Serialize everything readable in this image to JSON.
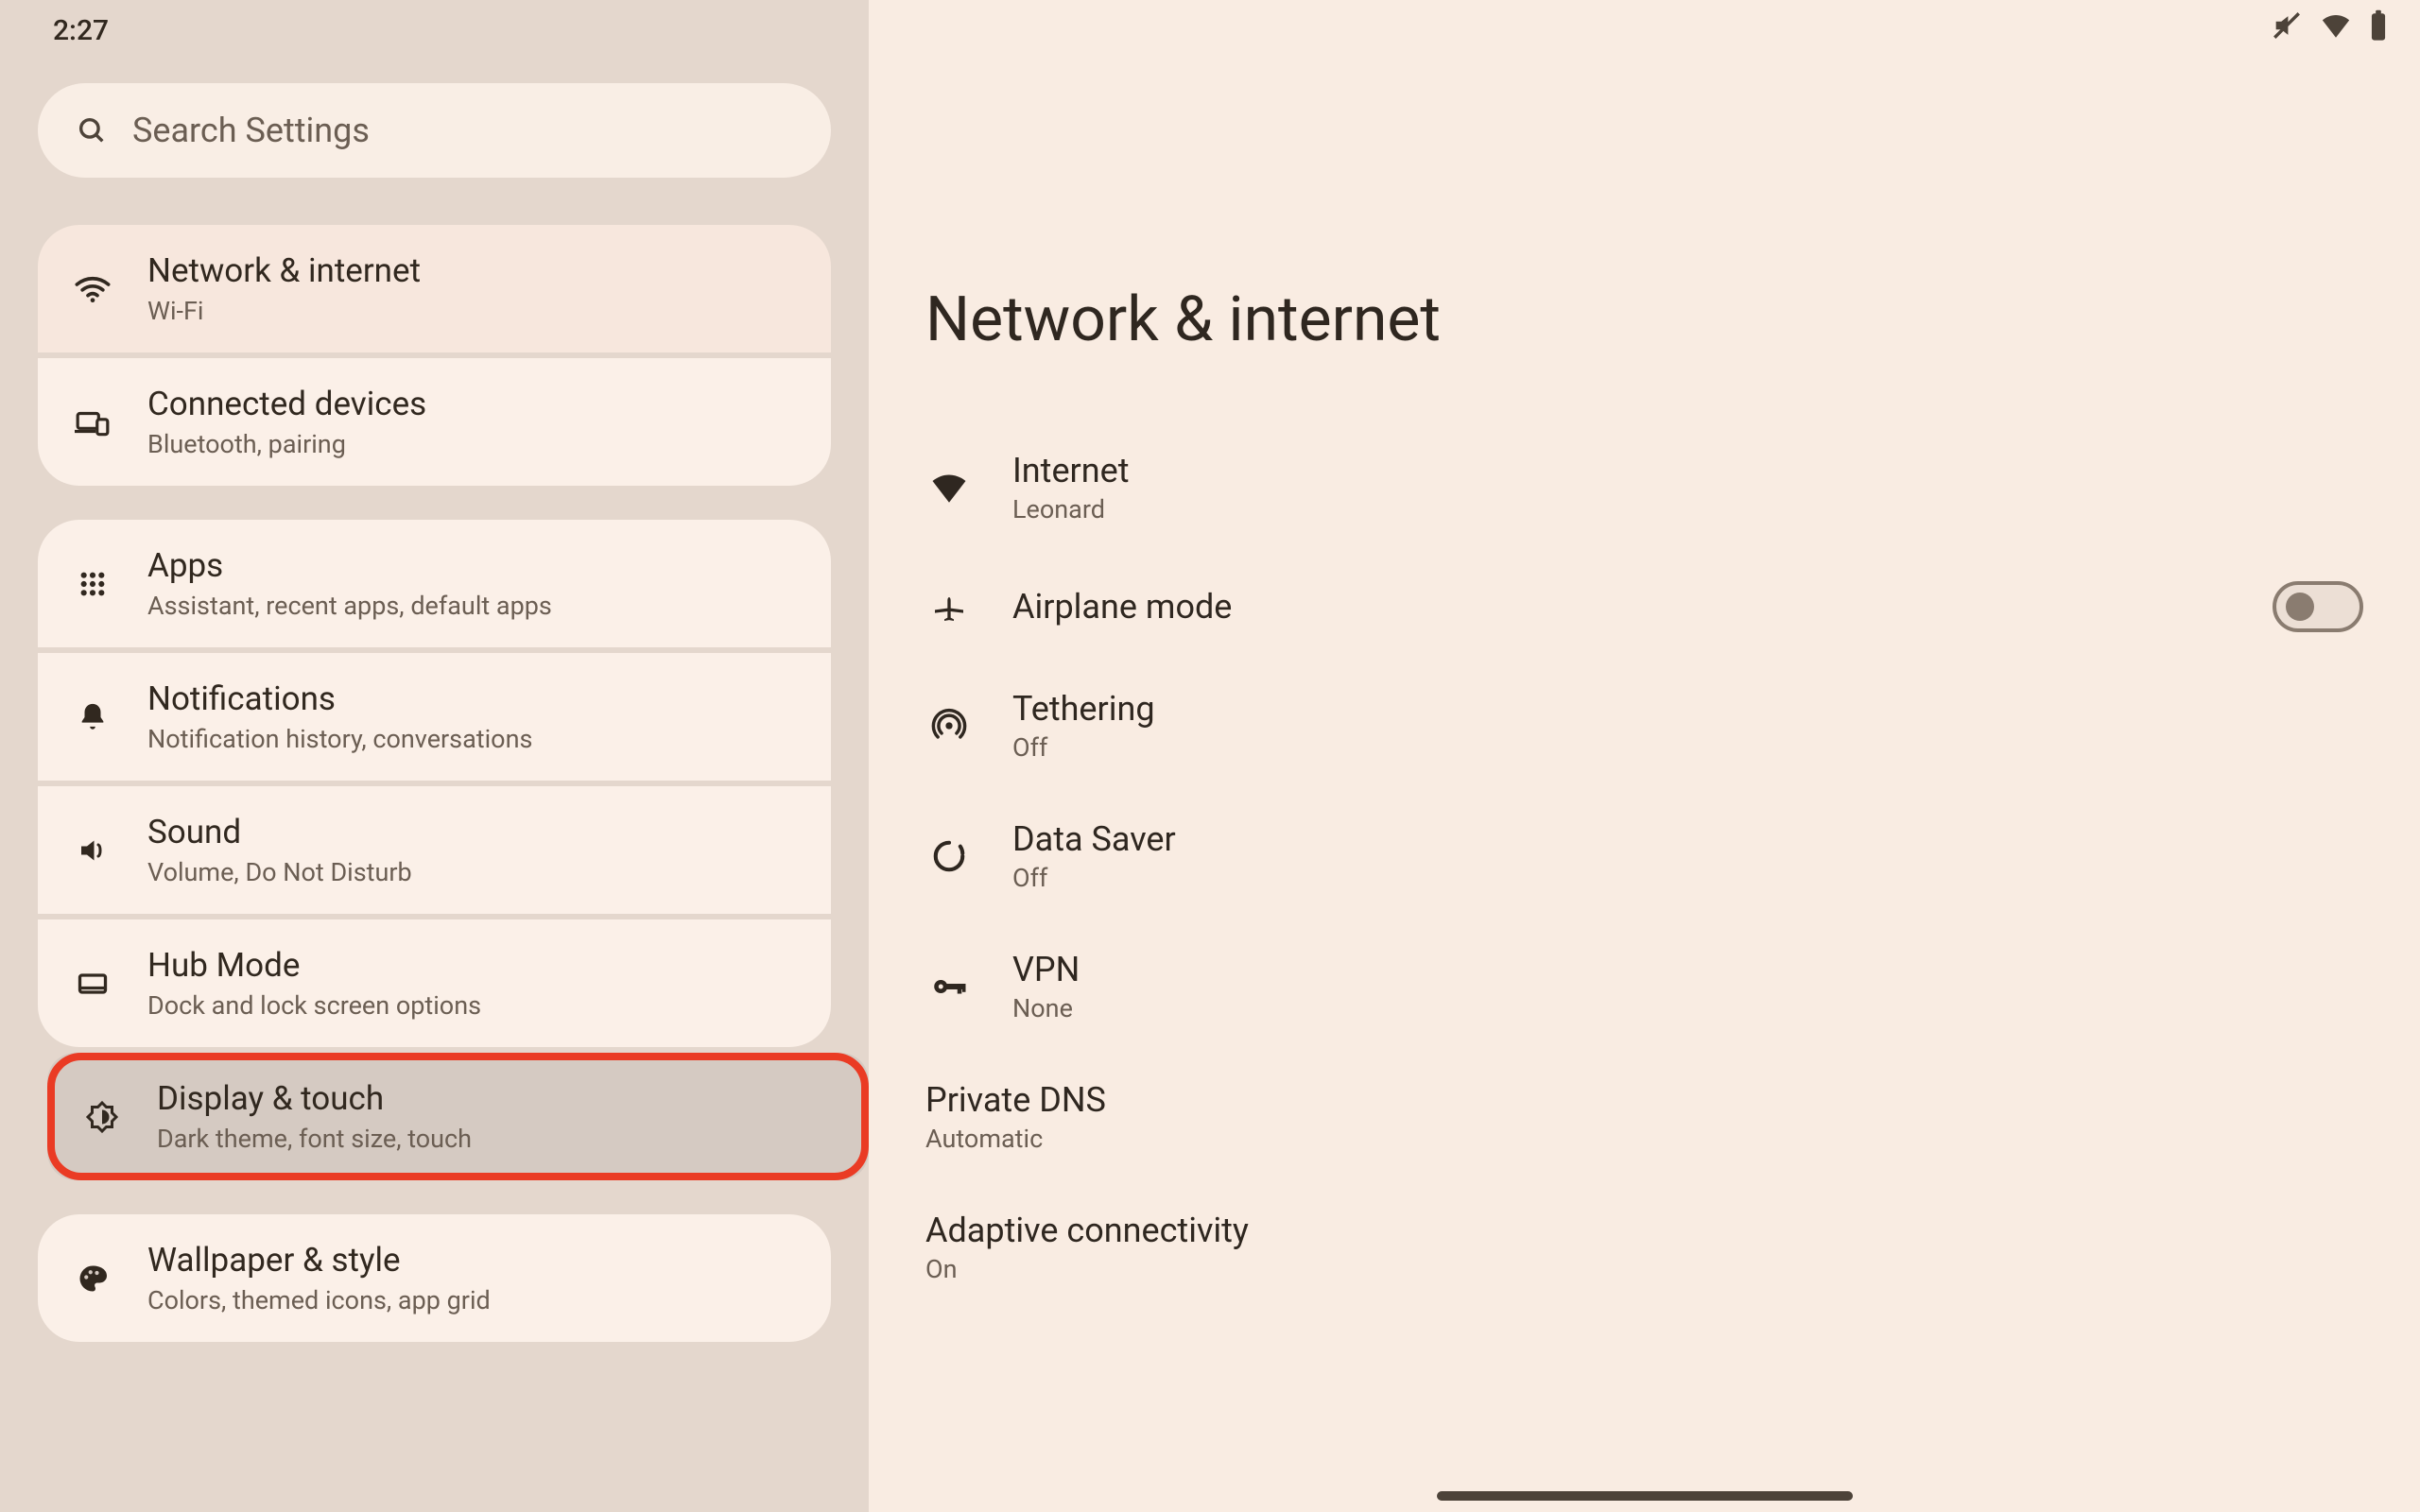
{
  "status_bar": {
    "time": "2:27"
  },
  "search": {
    "placeholder": "Search Settings"
  },
  "sidebar": {
    "groups": [
      [
        {
          "title": "Network & internet",
          "subtitle": "Wi-Fi"
        },
        {
          "title": "Connected devices",
          "subtitle": "Bluetooth, pairing"
        }
      ],
      [
        {
          "title": "Apps",
          "subtitle": "Assistant, recent apps, default apps"
        },
        {
          "title": "Notifications",
          "subtitle": "Notification history, conversations"
        },
        {
          "title": "Sound",
          "subtitle": "Volume, Do Not Disturb"
        },
        {
          "title": "Hub Mode",
          "subtitle": "Dock and lock screen options"
        },
        {
          "title": "Display & touch",
          "subtitle": "Dark theme, font size, touch"
        },
        {
          "title": "Wallpaper & style",
          "subtitle": "Colors, themed icons, app grid"
        }
      ]
    ]
  },
  "detail": {
    "title": "Network & internet",
    "rows": [
      {
        "title": "Internet",
        "subtitle": "Leonard"
      },
      {
        "title": "Airplane mode",
        "toggle": "off"
      },
      {
        "title": "Tethering",
        "subtitle": "Off"
      },
      {
        "title": "Data Saver",
        "subtitle": "Off"
      },
      {
        "title": "VPN",
        "subtitle": "None"
      },
      {
        "title": "Private DNS",
        "subtitle": "Automatic"
      },
      {
        "title": "Adaptive connectivity",
        "subtitle": "On"
      }
    ]
  }
}
